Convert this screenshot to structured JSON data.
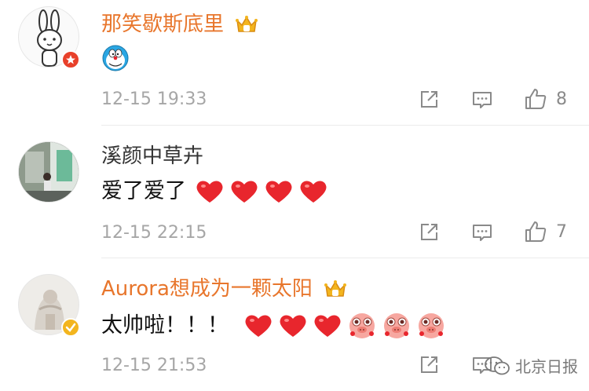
{
  "comments": [
    {
      "username": "那笑歇斯底里",
      "text": "",
      "emoji": "doraemon-emoji",
      "timestamp": "12-15 19:33",
      "like_count": "8"
    },
    {
      "username": "溪颜中草卉",
      "text": "爱了爱了",
      "emoji": "red-heart",
      "timestamp": "12-15 22:15",
      "like_count": "7"
    },
    {
      "username": "Aurora想成为一颗太阳",
      "text": "太帅啦！！！",
      "emoji": "red-heart, blushing-pig",
      "timestamp": "12-15 21:53",
      "like_count": ""
    }
  ],
  "watermark": "北京日报",
  "colors": {
    "vip_name": "#e8762c",
    "heart": "#e8262d",
    "muted": "#a6a6a6"
  }
}
